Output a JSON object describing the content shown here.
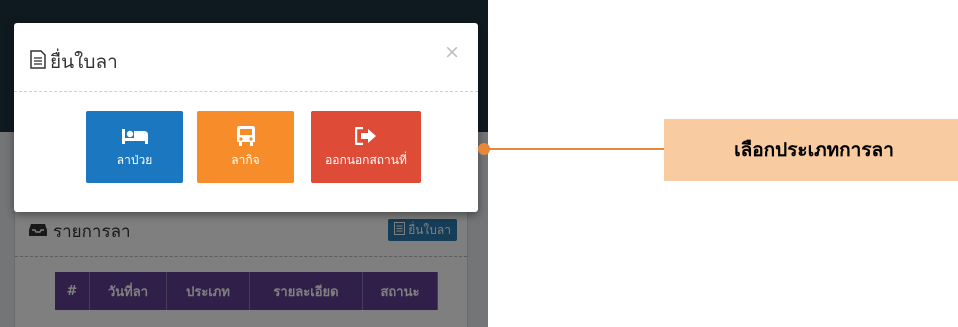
{
  "modal": {
    "title": "ยื่นใบลา",
    "close_label": "×",
    "options": [
      {
        "label": "ลาป่วย",
        "icon": "bed-icon",
        "color": "#1a77c0"
      },
      {
        "label": "ลากิจ",
        "icon": "bus-icon",
        "color": "#f78d2a"
      },
      {
        "label": "ออกนอกสถานที่",
        "icon": "sign-out-icon",
        "color": "#de4b37"
      }
    ]
  },
  "panel": {
    "title": "รายการลา",
    "button_label": "ยื่นใบลา",
    "table": {
      "headers": [
        "#",
        "วันที่ลา",
        "ประเภท",
        "รายละเอียด",
        "สถานะ"
      ]
    }
  },
  "callout": {
    "text": "เลือกประเภทการลา"
  },
  "colors": {
    "header": "#1f3341",
    "table_header": "#5e3f92",
    "callout": "#f9cba1",
    "connector": "#e8873a"
  }
}
